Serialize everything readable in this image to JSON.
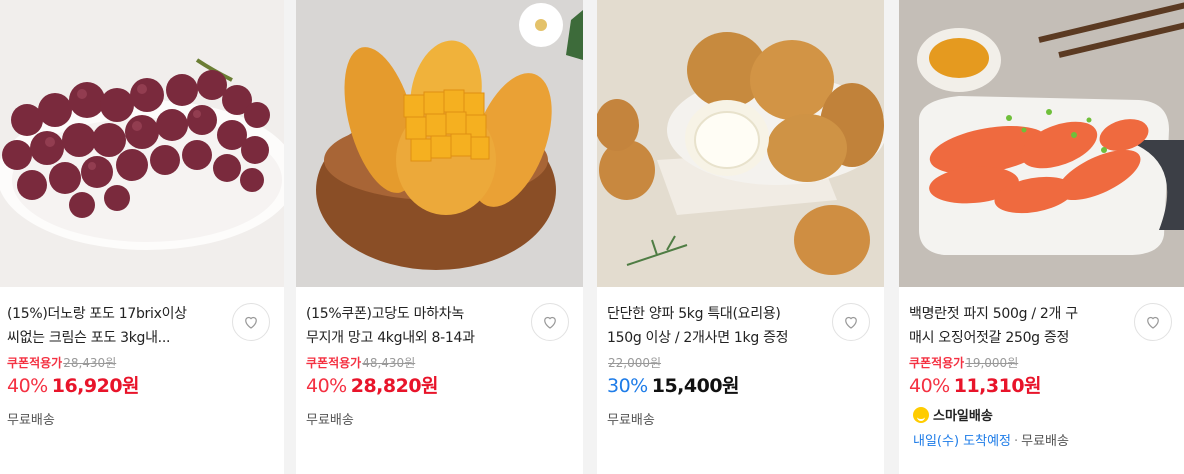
{
  "products": [
    {
      "title_lines": [
        "(15%)더노랑 포도 17brix이상",
        "씨없는 크림슨 포도 3kg내..."
      ],
      "coupon_label": "쿠폰적용가",
      "original_price": "28,430원",
      "discount_rate": "40%",
      "sale_price": "16,920원",
      "shipping": "무료배송",
      "image": "red-grapes-image"
    },
    {
      "title_lines": [
        "(15%쿠폰)고당도 마하차녹",
        "무지개 망고 4kg내외 8-14과"
      ],
      "coupon_label": "쿠폰적용가",
      "original_price": "48,430원",
      "discount_rate": "40%",
      "sale_price": "28,820원",
      "shipping": "무료배송",
      "image": "mango-bowl-image"
    },
    {
      "title_lines": [
        "단단한 양파 5kg 특대(요리용)",
        "150g 이상 / 2개사면 1kg 증정"
      ],
      "coupon_label": "",
      "original_price": "22,000원",
      "discount_rate": "30%",
      "sale_price": "15,400원",
      "shipping": "무료배송",
      "image": "onions-image"
    },
    {
      "title_lines": [
        "백명란젓 파지 500g / 2개 구",
        "매시 오징어젓갈 250g 증정"
      ],
      "coupon_label": "쿠폰적용가",
      "original_price": "19,000원",
      "discount_rate": "40%",
      "sale_price": "11,310원",
      "smile_label": "스마일배송",
      "arrival_date": "내일(수) 도착예정",
      "shipping": "무료배송",
      "image": "pollock-roe-image"
    }
  ],
  "colors": {
    "coupon_red": "#f43142",
    "price_red": "#e8142a",
    "rate_blue": "#1e7ce8",
    "smile_yellow": "#ffcc00"
  },
  "icons": {
    "wishlist": "heart-outline-icon",
    "smile_delivery": "smile-icon"
  }
}
